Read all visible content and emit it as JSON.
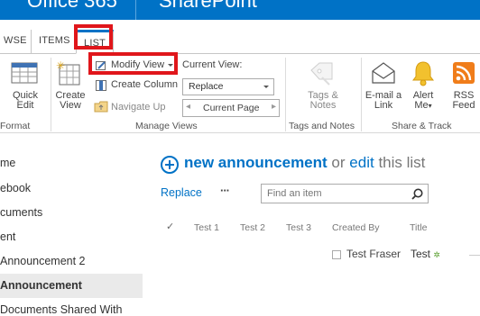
{
  "suite": {
    "brand_left": "Office 365",
    "brand_right": "SharePoint"
  },
  "tabs": [
    {
      "label": "WSE"
    },
    {
      "label": "ITEMS"
    },
    {
      "label": "LIST"
    }
  ],
  "ribbon": {
    "quick_edit": {
      "line1": "Quick",
      "line2": "Edit"
    },
    "create_view": {
      "line1": "Create",
      "line2": "View"
    },
    "modify_view": "Modify View",
    "create_column": "Create Column",
    "navigate_up": "Navigate Up",
    "current_view_label": "Current View:",
    "current_view_value": "Replace",
    "current_page": "Current Page",
    "tags_notes": {
      "line1": "Tags &",
      "line2": "Notes"
    },
    "email_link": {
      "line1": "E-mail a",
      "line2": "Link"
    },
    "alert_me": {
      "line1": "Alert",
      "line2": "Me"
    },
    "rss_feed": {
      "line1": "RSS",
      "line2": "Feed"
    },
    "groups": {
      "format": "Format",
      "manage_views": "Manage Views",
      "tags_and_notes": "Tags and Notes",
      "share_track": "Share & Track"
    }
  },
  "leftnav": [
    {
      "label": "me"
    },
    {
      "label": "ebook"
    },
    {
      "label": "cuments"
    },
    {
      "label": "ent"
    },
    {
      "label": "Announcement 2"
    },
    {
      "label": "Announcement"
    },
    {
      "label": "Documents Shared With"
    }
  ],
  "main": {
    "new_text": "new announcement",
    "or_text": "or",
    "edit_text": "edit",
    "this_list_text": "this list",
    "view_name": "Replace",
    "more": "···",
    "search_placeholder": "Find an item",
    "columns": [
      "Test 1",
      "Test 2",
      "Test 3",
      "Created By",
      "Title"
    ],
    "row": {
      "created_by": "Test Fraser",
      "title": "Test",
      "new_badge": "✲"
    }
  },
  "colors": {
    "accent": "#0072c6",
    "highlight": "#e0161b"
  }
}
